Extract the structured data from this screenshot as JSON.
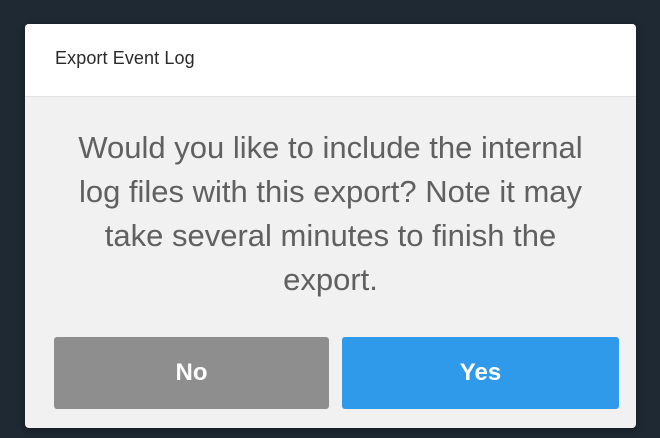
{
  "dialog": {
    "title": "Export Event Log",
    "message": "Would you like to include the internal log files with this export? Note it may take several minutes to finish the export.",
    "buttons": {
      "no_label": "No",
      "yes_label": "Yes"
    }
  },
  "colors": {
    "backdrop": "#1f2933",
    "dialog_background": "#f1f1f1",
    "header_background": "#ffffff",
    "no_button": "#8e8e8e",
    "yes_button": "#2f9ae9"
  }
}
